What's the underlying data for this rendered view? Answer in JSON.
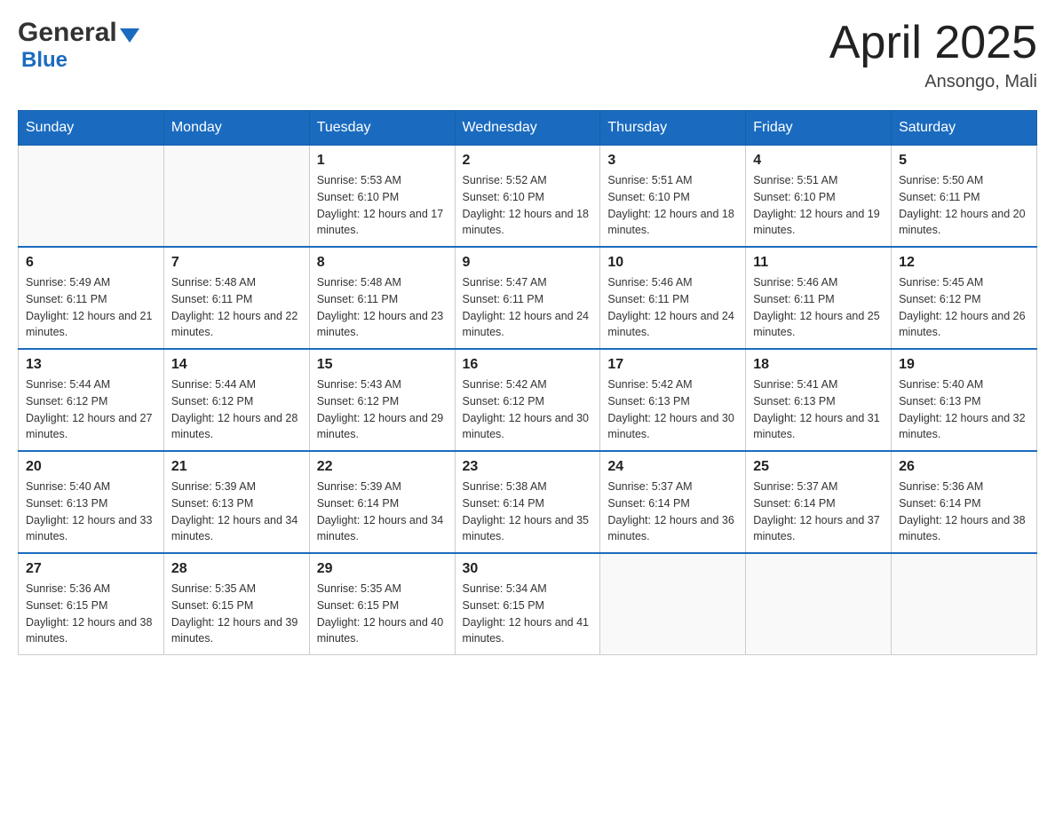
{
  "header": {
    "logo_general": "General",
    "logo_blue": "Blue",
    "month_title": "April 2025",
    "location": "Ansongo, Mali"
  },
  "weekdays": [
    "Sunday",
    "Monday",
    "Tuesday",
    "Wednesday",
    "Thursday",
    "Friday",
    "Saturday"
  ],
  "weeks": [
    [
      {
        "day": "",
        "sunrise": "",
        "sunset": "",
        "daylight": ""
      },
      {
        "day": "",
        "sunrise": "",
        "sunset": "",
        "daylight": ""
      },
      {
        "day": "1",
        "sunrise": "Sunrise: 5:53 AM",
        "sunset": "Sunset: 6:10 PM",
        "daylight": "Daylight: 12 hours and 17 minutes."
      },
      {
        "day": "2",
        "sunrise": "Sunrise: 5:52 AM",
        "sunset": "Sunset: 6:10 PM",
        "daylight": "Daylight: 12 hours and 18 minutes."
      },
      {
        "day": "3",
        "sunrise": "Sunrise: 5:51 AM",
        "sunset": "Sunset: 6:10 PM",
        "daylight": "Daylight: 12 hours and 18 minutes."
      },
      {
        "day": "4",
        "sunrise": "Sunrise: 5:51 AM",
        "sunset": "Sunset: 6:10 PM",
        "daylight": "Daylight: 12 hours and 19 minutes."
      },
      {
        "day": "5",
        "sunrise": "Sunrise: 5:50 AM",
        "sunset": "Sunset: 6:11 PM",
        "daylight": "Daylight: 12 hours and 20 minutes."
      }
    ],
    [
      {
        "day": "6",
        "sunrise": "Sunrise: 5:49 AM",
        "sunset": "Sunset: 6:11 PM",
        "daylight": "Daylight: 12 hours and 21 minutes."
      },
      {
        "day": "7",
        "sunrise": "Sunrise: 5:48 AM",
        "sunset": "Sunset: 6:11 PM",
        "daylight": "Daylight: 12 hours and 22 minutes."
      },
      {
        "day": "8",
        "sunrise": "Sunrise: 5:48 AM",
        "sunset": "Sunset: 6:11 PM",
        "daylight": "Daylight: 12 hours and 23 minutes."
      },
      {
        "day": "9",
        "sunrise": "Sunrise: 5:47 AM",
        "sunset": "Sunset: 6:11 PM",
        "daylight": "Daylight: 12 hours and 24 minutes."
      },
      {
        "day": "10",
        "sunrise": "Sunrise: 5:46 AM",
        "sunset": "Sunset: 6:11 PM",
        "daylight": "Daylight: 12 hours and 24 minutes."
      },
      {
        "day": "11",
        "sunrise": "Sunrise: 5:46 AM",
        "sunset": "Sunset: 6:11 PM",
        "daylight": "Daylight: 12 hours and 25 minutes."
      },
      {
        "day": "12",
        "sunrise": "Sunrise: 5:45 AM",
        "sunset": "Sunset: 6:12 PM",
        "daylight": "Daylight: 12 hours and 26 minutes."
      }
    ],
    [
      {
        "day": "13",
        "sunrise": "Sunrise: 5:44 AM",
        "sunset": "Sunset: 6:12 PM",
        "daylight": "Daylight: 12 hours and 27 minutes."
      },
      {
        "day": "14",
        "sunrise": "Sunrise: 5:44 AM",
        "sunset": "Sunset: 6:12 PM",
        "daylight": "Daylight: 12 hours and 28 minutes."
      },
      {
        "day": "15",
        "sunrise": "Sunrise: 5:43 AM",
        "sunset": "Sunset: 6:12 PM",
        "daylight": "Daylight: 12 hours and 29 minutes."
      },
      {
        "day": "16",
        "sunrise": "Sunrise: 5:42 AM",
        "sunset": "Sunset: 6:12 PM",
        "daylight": "Daylight: 12 hours and 30 minutes."
      },
      {
        "day": "17",
        "sunrise": "Sunrise: 5:42 AM",
        "sunset": "Sunset: 6:13 PM",
        "daylight": "Daylight: 12 hours and 30 minutes."
      },
      {
        "day": "18",
        "sunrise": "Sunrise: 5:41 AM",
        "sunset": "Sunset: 6:13 PM",
        "daylight": "Daylight: 12 hours and 31 minutes."
      },
      {
        "day": "19",
        "sunrise": "Sunrise: 5:40 AM",
        "sunset": "Sunset: 6:13 PM",
        "daylight": "Daylight: 12 hours and 32 minutes."
      }
    ],
    [
      {
        "day": "20",
        "sunrise": "Sunrise: 5:40 AM",
        "sunset": "Sunset: 6:13 PM",
        "daylight": "Daylight: 12 hours and 33 minutes."
      },
      {
        "day": "21",
        "sunrise": "Sunrise: 5:39 AM",
        "sunset": "Sunset: 6:13 PM",
        "daylight": "Daylight: 12 hours and 34 minutes."
      },
      {
        "day": "22",
        "sunrise": "Sunrise: 5:39 AM",
        "sunset": "Sunset: 6:14 PM",
        "daylight": "Daylight: 12 hours and 34 minutes."
      },
      {
        "day": "23",
        "sunrise": "Sunrise: 5:38 AM",
        "sunset": "Sunset: 6:14 PM",
        "daylight": "Daylight: 12 hours and 35 minutes."
      },
      {
        "day": "24",
        "sunrise": "Sunrise: 5:37 AM",
        "sunset": "Sunset: 6:14 PM",
        "daylight": "Daylight: 12 hours and 36 minutes."
      },
      {
        "day": "25",
        "sunrise": "Sunrise: 5:37 AM",
        "sunset": "Sunset: 6:14 PM",
        "daylight": "Daylight: 12 hours and 37 minutes."
      },
      {
        "day": "26",
        "sunrise": "Sunrise: 5:36 AM",
        "sunset": "Sunset: 6:14 PM",
        "daylight": "Daylight: 12 hours and 38 minutes."
      }
    ],
    [
      {
        "day": "27",
        "sunrise": "Sunrise: 5:36 AM",
        "sunset": "Sunset: 6:15 PM",
        "daylight": "Daylight: 12 hours and 38 minutes."
      },
      {
        "day": "28",
        "sunrise": "Sunrise: 5:35 AM",
        "sunset": "Sunset: 6:15 PM",
        "daylight": "Daylight: 12 hours and 39 minutes."
      },
      {
        "day": "29",
        "sunrise": "Sunrise: 5:35 AM",
        "sunset": "Sunset: 6:15 PM",
        "daylight": "Daylight: 12 hours and 40 minutes."
      },
      {
        "day": "30",
        "sunrise": "Sunrise: 5:34 AM",
        "sunset": "Sunset: 6:15 PM",
        "daylight": "Daylight: 12 hours and 41 minutes."
      },
      {
        "day": "",
        "sunrise": "",
        "sunset": "",
        "daylight": ""
      },
      {
        "day": "",
        "sunrise": "",
        "sunset": "",
        "daylight": ""
      },
      {
        "day": "",
        "sunrise": "",
        "sunset": "",
        "daylight": ""
      }
    ]
  ]
}
